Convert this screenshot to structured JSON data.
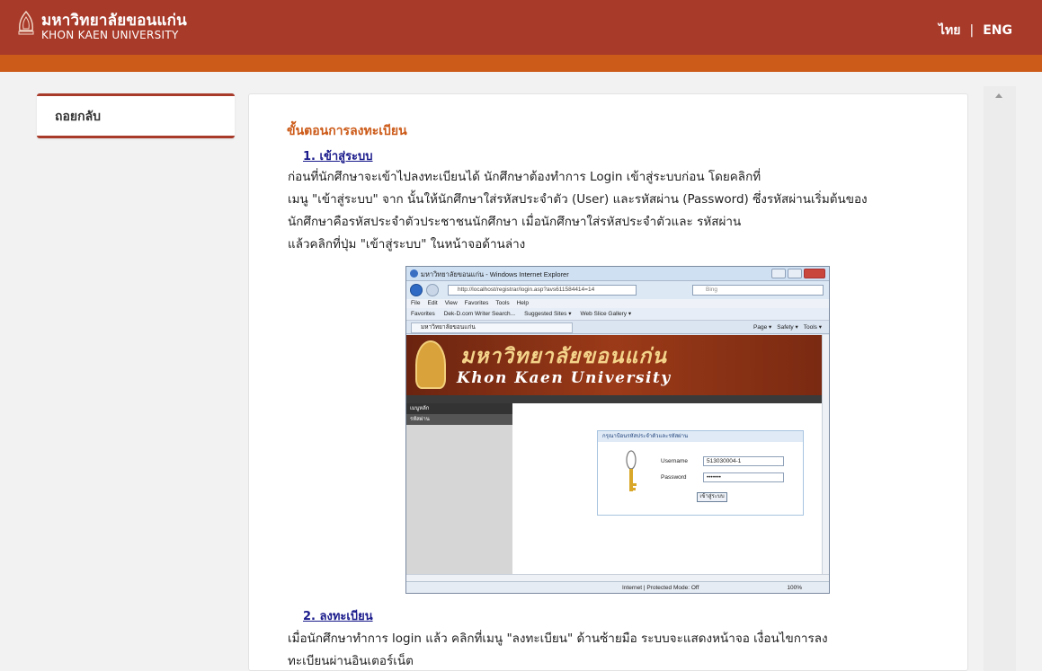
{
  "header": {
    "brand_th": "มหาวิทยาลัยขอนแก่น",
    "brand_en": "KHON KAEN UNIVERSITY",
    "lang_th": "ไทย",
    "lang_sep": "|",
    "lang_en": "ENG"
  },
  "sidebar": {
    "back_label": "ถอยกลับ"
  },
  "content": {
    "section_title": "ขั้นตอนการลงทะเบียน",
    "step1_title": "1. เข้าสู่ระบบ",
    "step1_lines": [
      "ก่อนที่นักศึกษาจะเข้าไปลงทะเบียนได้ นักศึกษาต้องทำการ Login เข้าสู่ระบบก่อน โดยคลิกที่",
      "เมนู \"เข้าสู่ระบบ\" จาก นั้นให้นักศึกษาใส่รหัสประจำตัว (User) และรหัสผ่าน (Password) ซึ่งรหัสผ่านเริ่มต้นของ",
      "นักศึกษาคือรหัสประจำตัวประชาชนนักศึกษา เมื่อนักศึกษาใส่รหัสประจำตัวและ รหัสผ่าน",
      "แล้วคลิกที่ปุ่ม \"เข้าสู่ระบบ\" ในหน้าจอด้านล่าง"
    ],
    "step2_title": "2. ลงทะเบียน",
    "step2_lines": [
      "เมื่อนักศึกษาทำการ login แล้ว คลิกที่เมนู \"ลงทะเบียน\" ด้านซ้ายมือ ระบบจะแสดงหน้าจอ เงื่อนไขการลง",
      "ทะเบียนผ่านอินเตอร์เน็ต"
    ]
  },
  "screenshot": {
    "window_title": "มหาวิทยาลัยขอนแก่น - Windows Internet Explorer",
    "url": "http://localhost/registrar/login.asp?avs611584414=14",
    "search_placeholder": "Bing",
    "menu": [
      "File",
      "Edit",
      "View",
      "Favorites",
      "Tools",
      "Help"
    ],
    "favorites": [
      "Favorites",
      "Dek-D.com Writer Search...",
      "Suggested Sites ▾",
      "Web Slice Gallery ▾"
    ],
    "tab_label": "มหาวิทยาลัยขอนแก่น",
    "commands": [
      "Page ▾",
      "Safety ▾",
      "Tools ▾"
    ],
    "banner_th": "มหาวิทยาลัยขอนแก่น",
    "banner_en": "Khon Kaen University",
    "side_items": [
      "เมนูหลัก",
      "รหัสผ่าน"
    ],
    "login_header": "กรุณาป้อนรหัสประจำตัวและรหัสผ่าน",
    "username_label": "Username",
    "username_value": "513030004-1",
    "password_label": "Password",
    "password_value": "•••••••",
    "login_button": "เข้าสู่ระบบ",
    "status_zone": "Internet | Protected Mode: Off",
    "status_zoom": "100%"
  }
}
